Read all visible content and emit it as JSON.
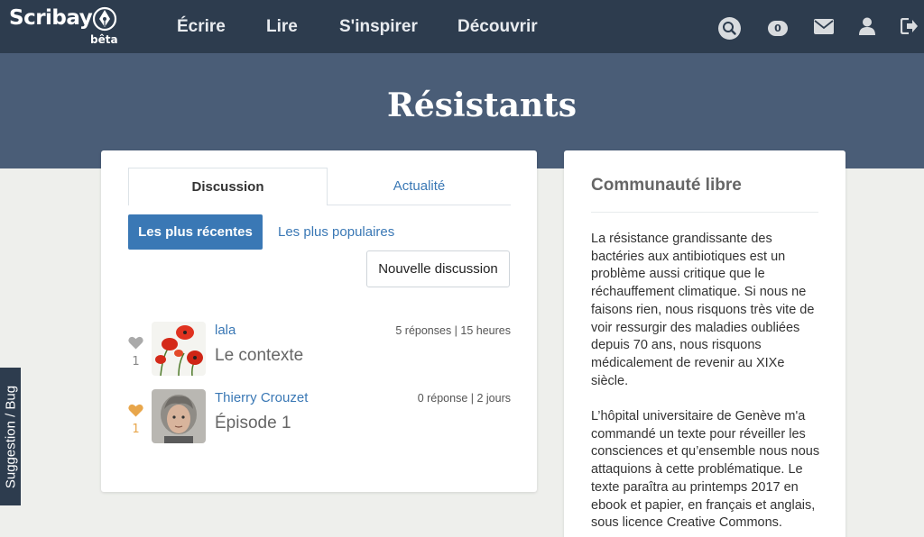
{
  "brand": {
    "name": "Scribay",
    "badge": "bêta"
  },
  "nav": {
    "links": [
      "Écrire",
      "Lire",
      "S'inspirer",
      "Découvrir"
    ]
  },
  "header_icons": {
    "search": "search-icon",
    "notifications_count": "0",
    "messages": "envelope-icon",
    "profile": "user-icon",
    "logout": "logout-icon"
  },
  "page": {
    "title": "Résistants"
  },
  "tabs": {
    "active": "Discussion",
    "inactive": "Actualité"
  },
  "filters": {
    "recent": "Les plus récentes",
    "popular": "Les plus populaires"
  },
  "new_discussion_label": "Nouvelle discussion",
  "discussions": [
    {
      "author": "lala",
      "meta": "5 réponses | 15 heures",
      "title": "Le contexte",
      "likes": "1",
      "liked": false
    },
    {
      "author": "Thierry Crouzet",
      "meta": "0 réponse | 2 jours",
      "title": "Épisode 1",
      "likes": "1",
      "liked": true
    }
  ],
  "sidebar": {
    "title": "Communauté libre",
    "paragraphs": [
      "La résistance grandissante des bactéries aux antibiotiques est un problème aussi critique que le réchauffement climatique. Si nous ne faisons rien, nous risquons très vite de voir ressurgir des maladies oubliées depuis 70 ans, nous risquons médicalement de revenir au XIXe siècle.",
      "L’hôpital universitaire de Genève m'a commandé un texte pour réveiller les consciences et qu’ensemble nous nous attaquions à cette problématique. Le texte paraîtra au printemps 2017 en ebook et papier, en français et anglais, sous licence Creative Commons."
    ]
  },
  "feedback_tab": "Suggestion / Bug",
  "colors": {
    "nav": "#2d3c4e",
    "hero": "#4a5d77",
    "accent": "#3a78b5",
    "heart_liked": "#e8a64b",
    "heart_default": "#aaaaaa",
    "background": "#eeefec"
  }
}
